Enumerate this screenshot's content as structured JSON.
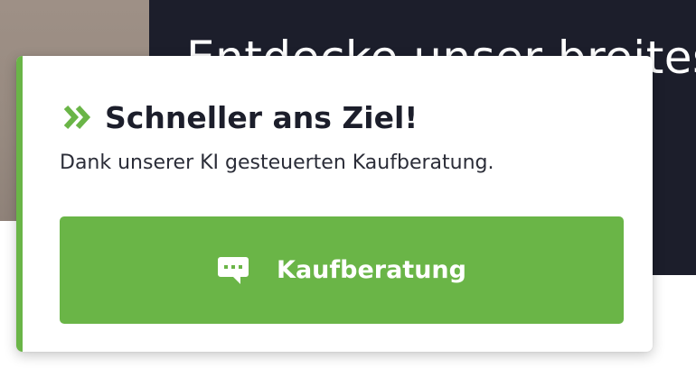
{
  "background": {
    "headline": "Entdecke unser breites A",
    "image_color": "#978a80",
    "panel_color": "#1c1e2b"
  },
  "card": {
    "title": "Schneller ans Ziel!",
    "subtitle": "Dank unserer KI gesteuerten Kaufberatung.",
    "title_icon": "double-chevron-right-icon",
    "accent_color": "#6ab547",
    "button": {
      "label": "Kaufberatung",
      "icon": "chat-bubble-icon",
      "color": "#6ab547"
    }
  }
}
